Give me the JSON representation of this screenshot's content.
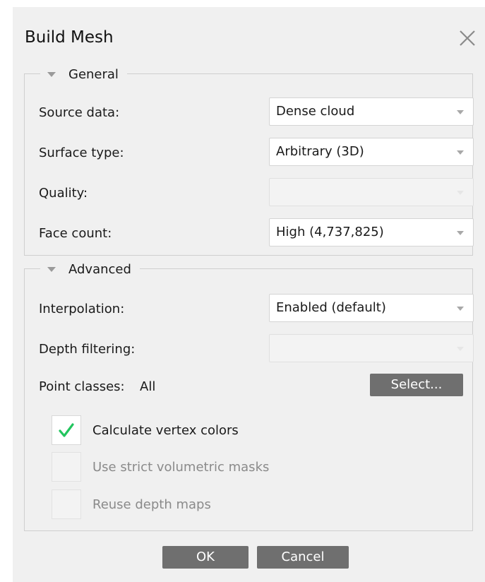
{
  "dialog": {
    "title": "Build Mesh",
    "close_icon": "close-icon"
  },
  "general": {
    "legend": "General",
    "source_data": {
      "label": "Source data:",
      "value": "Dense cloud"
    },
    "surface_type": {
      "label": "Surface type:",
      "value": "Arbitrary (3D)"
    },
    "quality": {
      "label": "Quality:",
      "value": ""
    },
    "face_count": {
      "label": "Face count:",
      "value": "High (4,737,825)"
    }
  },
  "advanced": {
    "legend": "Advanced",
    "interpolation": {
      "label": "Interpolation:",
      "value": "Enabled (default)"
    },
    "depth_filtering": {
      "label": "Depth filtering:",
      "value": ""
    },
    "point_classes": {
      "label": "Point classes:",
      "value": "All",
      "button": "Select..."
    },
    "calculate_vertex_colors": {
      "label": "Calculate vertex colors",
      "checked": true
    },
    "strict_volumetric_masks": {
      "label": "Use strict volumetric masks",
      "checked": false
    },
    "reuse_depth_maps": {
      "label": "Reuse depth maps",
      "checked": false
    }
  },
  "buttons": {
    "ok": "OK",
    "cancel": "Cancel"
  },
  "colors": {
    "dialog_bg": "#f0f0f0",
    "button_bg": "#6f6f6f",
    "check_green": "#22c55e"
  }
}
